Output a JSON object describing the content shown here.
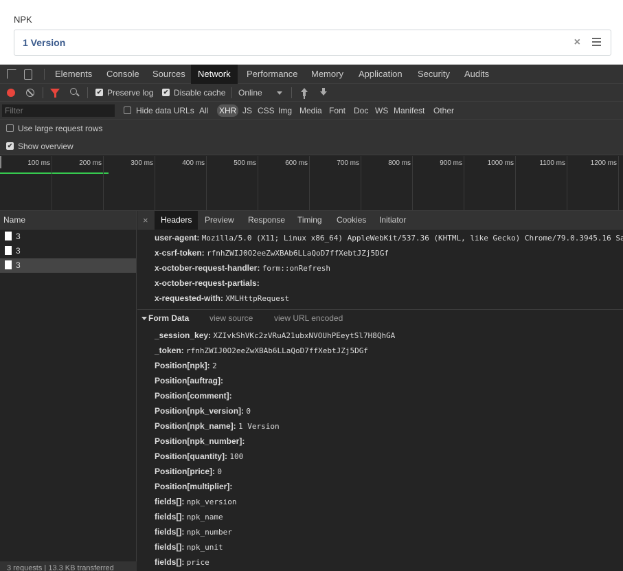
{
  "app": {
    "field_label": "NPK",
    "field_value": "1 Version",
    "clear_glyph": "×"
  },
  "devtools": {
    "tabs": [
      "Elements",
      "Console",
      "Sources",
      "Network",
      "Performance",
      "Memory",
      "Application",
      "Security",
      "Audits"
    ],
    "toolbar": {
      "preserve_log": "Preserve log",
      "disable_cache": "Disable cache",
      "throttle": "Online",
      "check": "✔"
    },
    "filter": {
      "placeholder": "Filter",
      "hide_data_urls": "Hide data URLs",
      "types": [
        "All",
        "XHR",
        "JS",
        "CSS",
        "Img",
        "Media",
        "Font",
        "Doc",
        "WS",
        "Manifest",
        "Other"
      ]
    },
    "options": {
      "large_rows": "Use large request rows",
      "show_overview": "Show overview"
    },
    "overview_ticks": [
      "100 ms",
      "200 ms",
      "300 ms",
      "400 ms",
      "500 ms",
      "600 ms",
      "700 ms",
      "800 ms",
      "900 ms",
      "1000 ms",
      "1100 ms",
      "1200 ms"
    ],
    "name_header": "Name",
    "requests": [
      "3",
      "3",
      "3"
    ],
    "status": "3 requests | 13.3 KB transferred",
    "detail_tabs": [
      "Headers",
      "Preview",
      "Response",
      "Timing",
      "Cookies",
      "Initiator"
    ],
    "close_glyph": "×",
    "request_headers": [
      {
        "k": "user-agent:",
        "v": "Mozilla/5.0 (X11; Linux x86_64) AppleWebKit/537.36 (KHTML, like Gecko) Chrome/79.0.3945.16 Sa"
      },
      {
        "k": "x-csrf-token:",
        "v": "rfnhZWIJ0O2eeZwXBAb6LLaQoD7ffXebtJZj5DGf"
      },
      {
        "k": "x-october-request-handler:",
        "v": "form::onRefresh"
      },
      {
        "k": "x-october-request-partials:",
        "v": ""
      },
      {
        "k": "x-requested-with:",
        "v": "XMLHttpRequest"
      }
    ],
    "form_data": {
      "title": "Form Data",
      "view_source": "view source",
      "view_url_encoded": "view URL encoded",
      "rows": [
        {
          "k": "_session_key:",
          "v": "XZIvkShVKc2zVRuA21ubxNVOUhPEeytSl7H8QhGA"
        },
        {
          "k": "_token:",
          "v": "rfnhZWIJ0O2eeZwXBAb6LLaQoD7ffXebtJZj5DGf"
        },
        {
          "k": "Position[npk]:",
          "v": "2"
        },
        {
          "k": "Position[auftrag]:",
          "v": ""
        },
        {
          "k": "Position[comment]:",
          "v": ""
        },
        {
          "k": "Position[npk_version]:",
          "v": "0"
        },
        {
          "k": "Position[npk_name]:",
          "v": "1 Version"
        },
        {
          "k": "Position[npk_number]:",
          "v": ""
        },
        {
          "k": "Position[quantity]:",
          "v": "100"
        },
        {
          "k": "Position[price]:",
          "v": "0"
        },
        {
          "k": "Position[multiplier]:",
          "v": ""
        },
        {
          "k": "fields[]:",
          "v": "npk_version"
        },
        {
          "k": "fields[]:",
          "v": "npk_name"
        },
        {
          "k": "fields[]:",
          "v": "npk_number"
        },
        {
          "k": "fields[]:",
          "v": "npk_unit"
        },
        {
          "k": "fields[]:",
          "v": "price"
        }
      ]
    }
  }
}
